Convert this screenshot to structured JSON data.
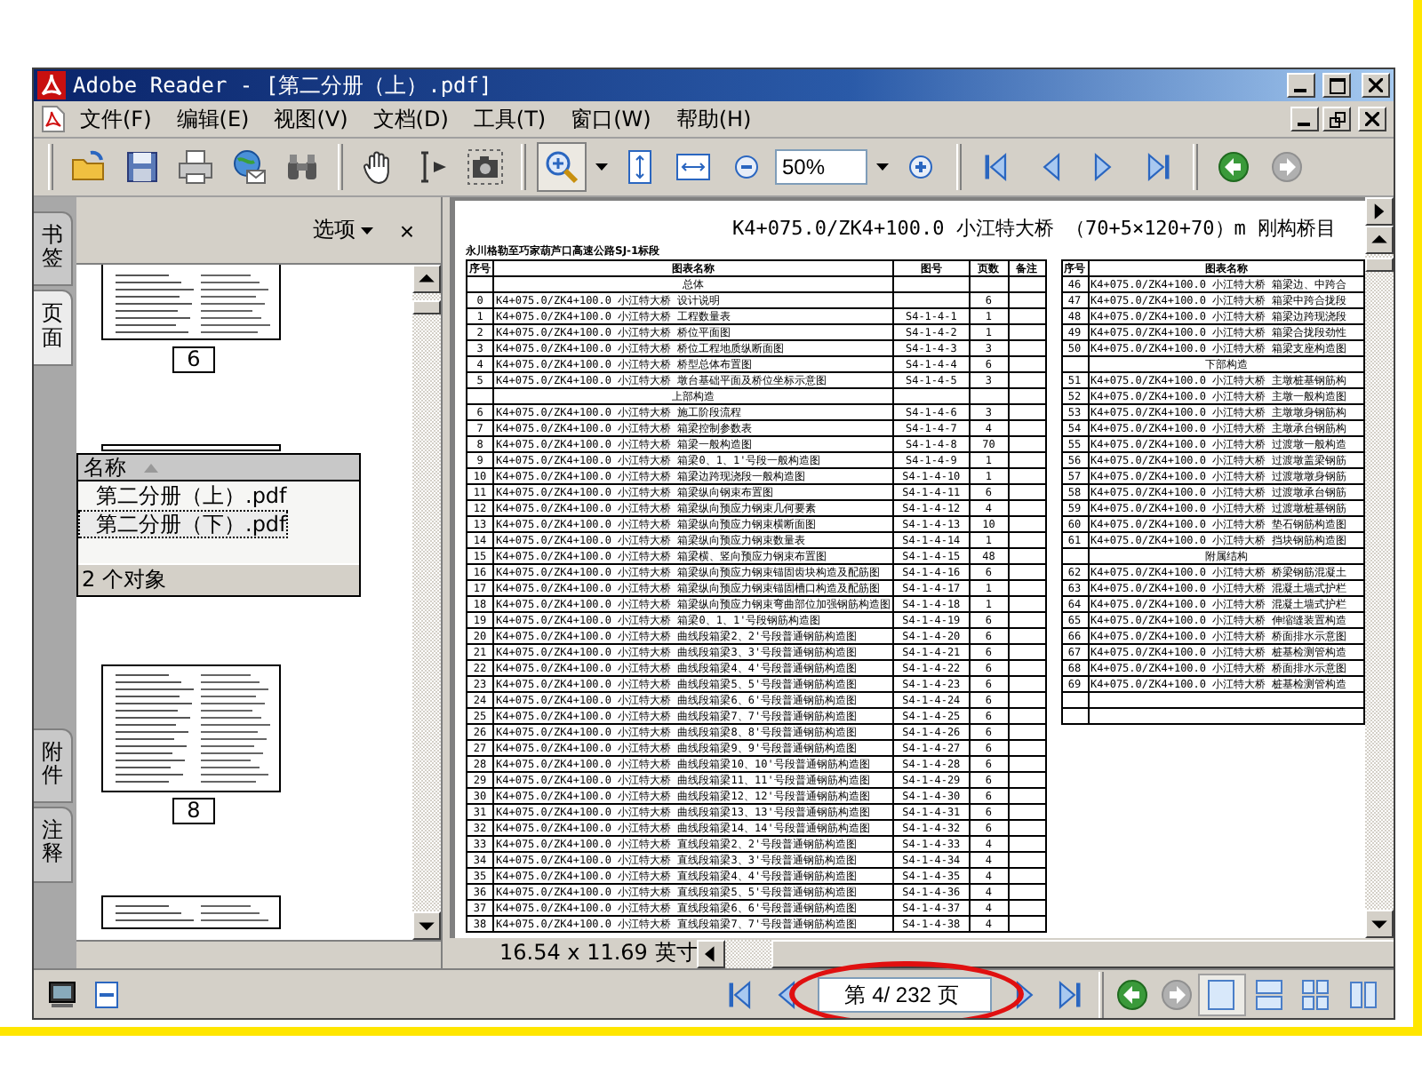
{
  "window": {
    "title": "Adobe Reader - [第二分册（上）.pdf]"
  },
  "menu": [
    {
      "label": "文件(F)"
    },
    {
      "label": "编辑(E)"
    },
    {
      "label": "视图(V)"
    },
    {
      "label": "文档(D)"
    },
    {
      "label": "工具(T)"
    },
    {
      "label": "窗口(W)"
    },
    {
      "label": "帮助(H)"
    }
  ],
  "toolbar": {
    "zoom_tool": {
      "selected": true
    },
    "zoom": {
      "value": "50%"
    },
    "history": [
      {
        "kind": "back",
        "disabled": false
      },
      {
        "kind": "forward",
        "disabled": true
      }
    ]
  },
  "side_tabs": [
    {
      "label": "书签",
      "selected": false
    },
    {
      "label": "页面",
      "selected": true
    },
    {
      "label": "附件",
      "selected": false
    },
    {
      "label": "注释",
      "selected": false
    }
  ],
  "nav_panel": {
    "options": "选项",
    "close": "×",
    "thumbnails": [
      {
        "label": "6"
      },
      {
        "label": "8"
      }
    ],
    "attachments": {
      "column": "名称",
      "files": [
        {
          "name": "第二分册（上）.pdf",
          "selected": false
        },
        {
          "name": "第二分册（下）.pdf",
          "selected": true
        }
      ],
      "count": "2 个对象"
    }
  },
  "document": {
    "title": "K4+075.0/ZK4+100.0 小江特大桥 （70+5×120+70）m 刚构桥目",
    "subtitle": "永川格勒至巧家葫芦口高速公路SJ-1标段",
    "columns": [
      "序号",
      "图表名称",
      "图号",
      "页数",
      "备注"
    ],
    "rows": [
      {
        "kind": "section",
        "name": "总体"
      },
      {
        "kind": "item",
        "no": "0",
        "name": "K4+075.0/ZK4+100.0 小江特大桥 设计说明",
        "code": "",
        "pages": "6"
      },
      {
        "kind": "item",
        "no": "1",
        "name": "K4+075.0/ZK4+100.0 小江特大桥 工程数量表",
        "code": "S4-1-4-1",
        "pages": "1"
      },
      {
        "kind": "item",
        "no": "2",
        "name": "K4+075.0/ZK4+100.0 小江特大桥 桥位平面图",
        "code": "S4-1-4-2",
        "pages": "1"
      },
      {
        "kind": "item",
        "no": "3",
        "name": "K4+075.0/ZK4+100.0 小江特大桥 桥位工程地质纵断面图",
        "code": "S4-1-4-3",
        "pages": "3"
      },
      {
        "kind": "item",
        "no": "4",
        "name": "K4+075.0/ZK4+100.0 小江特大桥 桥型总体布置图",
        "code": "S4-1-4-4",
        "pages": "6"
      },
      {
        "kind": "item",
        "no": "5",
        "name": "K4+075.0/ZK4+100.0 小江特大桥 墩台基础平面及桥位坐标示意图",
        "code": "S4-1-4-5",
        "pages": "3"
      },
      {
        "kind": "section",
        "name": "上部构造"
      },
      {
        "kind": "item",
        "no": "6",
        "name": "K4+075.0/ZK4+100.0 小江特大桥 施工阶段流程",
        "code": "S4-1-4-6",
        "pages": "3"
      },
      {
        "kind": "item",
        "no": "7",
        "name": "K4+075.0/ZK4+100.0 小江特大桥 箱梁控制参数表",
        "code": "S4-1-4-7",
        "pages": "4"
      },
      {
        "kind": "item",
        "no": "8",
        "name": "K4+075.0/ZK4+100.0 小江特大桥 箱梁一般构造图",
        "code": "S4-1-4-8",
        "pages": "70"
      },
      {
        "kind": "item",
        "no": "9",
        "name": "K4+075.0/ZK4+100.0 小江特大桥 箱梁0、1、1'号段一般构造图",
        "code": "S4-1-4-9",
        "pages": "1"
      },
      {
        "kind": "item",
        "no": "10",
        "name": "K4+075.0/ZK4+100.0 小江特大桥 箱梁边跨现浇段一般构造图",
        "code": "S4-1-4-10",
        "pages": "1"
      },
      {
        "kind": "item",
        "no": "11",
        "name": "K4+075.0/ZK4+100.0 小江特大桥 箱梁纵向钢束布置图",
        "code": "S4-1-4-11",
        "pages": "6"
      },
      {
        "kind": "item",
        "no": "12",
        "name": "K4+075.0/ZK4+100.0 小江特大桥 箱梁纵向预应力钢束几何要素",
        "code": "S4-1-4-12",
        "pages": "4"
      },
      {
        "kind": "item",
        "no": "13",
        "name": "K4+075.0/ZK4+100.0 小江特大桥 箱梁纵向预应力钢束横断面图",
        "code": "S4-1-4-13",
        "pages": "10"
      },
      {
        "kind": "item",
        "no": "14",
        "name": "K4+075.0/ZK4+100.0 小江特大桥 箱梁纵向预应力钢束数量表",
        "code": "S4-1-4-14",
        "pages": "1"
      },
      {
        "kind": "item",
        "no": "15",
        "name": "K4+075.0/ZK4+100.0 小江特大桥 箱梁横、竖向预应力钢束布置图",
        "code": "S4-1-4-15",
        "pages": "48"
      },
      {
        "kind": "item",
        "no": "16",
        "name": "K4+075.0/ZK4+100.0 小江特大桥 箱梁纵向预应力钢束锚固齿块构造及配筋图",
        "code": "S4-1-4-16",
        "pages": "6"
      },
      {
        "kind": "item",
        "no": "17",
        "name": "K4+075.0/ZK4+100.0 小江特大桥 箱梁纵向预应力钢束锚固槽口构造及配筋图",
        "code": "S4-1-4-17",
        "pages": "1"
      },
      {
        "kind": "item",
        "no": "18",
        "name": "K4+075.0/ZK4+100.0 小江特大桥 箱梁纵向预应力钢束弯曲部位加强钢筋构造图",
        "code": "S4-1-4-18",
        "pages": "1"
      },
      {
        "kind": "item",
        "no": "19",
        "name": "K4+075.0/ZK4+100.0 小江特大桥 箱梁0、1、1'号段钢筋构造图",
        "code": "S4-1-4-19",
        "pages": "6"
      },
      {
        "kind": "item",
        "no": "20",
        "name": "K4+075.0/ZK4+100.0 小江特大桥 曲线段箱梁2、2'号段普通钢筋构造图",
        "code": "S4-1-4-20",
        "pages": "6"
      },
      {
        "kind": "item",
        "no": "21",
        "name": "K4+075.0/ZK4+100.0 小江特大桥 曲线段箱梁3、3'号段普通钢筋构造图",
        "code": "S4-1-4-21",
        "pages": "6"
      },
      {
        "kind": "item",
        "no": "22",
        "name": "K4+075.0/ZK4+100.0 小江特大桥 曲线段箱梁4、4'号段普通钢筋构造图",
        "code": "S4-1-4-22",
        "pages": "6"
      },
      {
        "kind": "item",
        "no": "23",
        "name": "K4+075.0/ZK4+100.0 小江特大桥 曲线段箱梁5、5'号段普通钢筋构造图",
        "code": "S4-1-4-23",
        "pages": "6"
      },
      {
        "kind": "item",
        "no": "24",
        "name": "K4+075.0/ZK4+100.0 小江特大桥 曲线段箱梁6、6'号段普通钢筋构造图",
        "code": "S4-1-4-24",
        "pages": "6"
      },
      {
        "kind": "item",
        "no": "25",
        "name": "K4+075.0/ZK4+100.0 小江特大桥 曲线段箱梁7、7'号段普通钢筋构造图",
        "code": "S4-1-4-25",
        "pages": "6"
      },
      {
        "kind": "item",
        "no": "26",
        "name": "K4+075.0/ZK4+100.0 小江特大桥 曲线段箱梁8、8'号段普通钢筋构造图",
        "code": "S4-1-4-26",
        "pages": "6"
      },
      {
        "kind": "item",
        "no": "27",
        "name": "K4+075.0/ZK4+100.0 小江特大桥 曲线段箱梁9、9'号段普通钢筋构造图",
        "code": "S4-1-4-27",
        "pages": "6"
      },
      {
        "kind": "item",
        "no": "28",
        "name": "K4+075.0/ZK4+100.0 小江特大桥 曲线段箱梁10、10'号段普通钢筋构造图",
        "code": "S4-1-4-28",
        "pages": "6"
      },
      {
        "kind": "item",
        "no": "29",
        "name": "K4+075.0/ZK4+100.0 小江特大桥 曲线段箱梁11、11'号段普通钢筋构造图",
        "code": "S4-1-4-29",
        "pages": "6"
      },
      {
        "kind": "item",
        "no": "30",
        "name": "K4+075.0/ZK4+100.0 小江特大桥 曲线段箱梁12、12'号段普通钢筋构造图",
        "code": "S4-1-4-30",
        "pages": "6"
      },
      {
        "kind": "item",
        "no": "31",
        "name": "K4+075.0/ZK4+100.0 小江特大桥 曲线段箱梁13、13'号段普通钢筋构造图",
        "code": "S4-1-4-31",
        "pages": "6"
      },
      {
        "kind": "item",
        "no": "32",
        "name": "K4+075.0/ZK4+100.0 小江特大桥 曲线段箱梁14、14'号段普通钢筋构造图",
        "code": "S4-1-4-32",
        "pages": "6"
      },
      {
        "kind": "item",
        "no": "33",
        "name": "K4+075.0/ZK4+100.0 小江特大桥 直线段箱梁2、2'号段普通钢筋构造图",
        "code": "S4-1-4-33",
        "pages": "4"
      },
      {
        "kind": "item",
        "no": "34",
        "name": "K4+075.0/ZK4+100.0 小江特大桥 直线段箱梁3、3'号段普通钢筋构造图",
        "code": "S4-1-4-34",
        "pages": "4"
      },
      {
        "kind": "item",
        "no": "35",
        "name": "K4+075.0/ZK4+100.0 小江特大桥 直线段箱梁4、4'号段普通钢筋构造图",
        "code": "S4-1-4-35",
        "pages": "4"
      },
      {
        "kind": "item",
        "no": "36",
        "name": "K4+075.0/ZK4+100.0 小江特大桥 直线段箱梁5、5'号段普通钢筋构造图",
        "code": "S4-1-4-36",
        "pages": "4"
      },
      {
        "kind": "item",
        "no": "37",
        "name": "K4+075.0/ZK4+100.0 小江特大桥 直线段箱梁6、6'号段普通钢筋构造图",
        "code": "S4-1-4-37",
        "pages": "4"
      },
      {
        "kind": "item",
        "no": "38",
        "name": "K4+075.0/ZK4+100.0 小江特大桥 直线段箱梁7、7'号段普通钢筋构造图",
        "code": "S4-1-4-38",
        "pages": "4"
      }
    ],
    "right_columns": [
      "序号",
      "图表名称"
    ],
    "right_rows": [
      {
        "kind": "item",
        "no": "46",
        "name": "K4+075.0/ZK4+100.0 小江特大桥 箱梁边、中跨合"
      },
      {
        "kind": "item",
        "no": "47",
        "name": "K4+075.0/ZK4+100.0 小江特大桥 箱梁中跨合拢段"
      },
      {
        "kind": "item",
        "no": "48",
        "name": "K4+075.0/ZK4+100.0 小江特大桥 箱梁边跨现浇段"
      },
      {
        "kind": "item",
        "no": "49",
        "name": "K4+075.0/ZK4+100.0 小江特大桥 箱梁合拢段劲性"
      },
      {
        "kind": "item",
        "no": "50",
        "name": "K4+075.0/ZK4+100.0 小江特大桥 箱梁支座构造图"
      },
      {
        "kind": "section",
        "name": "下部构造"
      },
      {
        "kind": "item",
        "no": "51",
        "name": "K4+075.0/ZK4+100.0 小江特大桥 主墩桩基钢筋构"
      },
      {
        "kind": "item",
        "no": "52",
        "name": "K4+075.0/ZK4+100.0 小江特大桥 主墩一般构造图"
      },
      {
        "kind": "item",
        "no": "53",
        "name": "K4+075.0/ZK4+100.0 小江特大桥 主墩墩身钢筋构"
      },
      {
        "kind": "item",
        "no": "54",
        "name": "K4+075.0/ZK4+100.0 小江特大桥 主墩承台钢筋构"
      },
      {
        "kind": "item",
        "no": "55",
        "name": "K4+075.0/ZK4+100.0 小江特大桥 过渡墩一般构造"
      },
      {
        "kind": "item",
        "no": "56",
        "name": "K4+075.0/ZK4+100.0 小江特大桥 过渡墩盖梁钢筋"
      },
      {
        "kind": "item",
        "no": "57",
        "name": "K4+075.0/ZK4+100.0 小江特大桥 过渡墩墩身钢筋"
      },
      {
        "kind": "item",
        "no": "58",
        "name": "K4+075.0/ZK4+100.0 小江特大桥 过渡墩承台钢筋"
      },
      {
        "kind": "item",
        "no": "59",
        "name": "K4+075.0/ZK4+100.0 小江特大桥 过渡墩桩基钢筋"
      },
      {
        "kind": "item",
        "no": "60",
        "name": "K4+075.0/ZK4+100.0 小江特大桥 垫石钢筋构造图"
      },
      {
        "kind": "item",
        "no": "61",
        "name": "K4+075.0/ZK4+100.0 小江特大桥 挡块钢筋构造图"
      },
      {
        "kind": "section",
        "name": "附属结构"
      },
      {
        "kind": "item",
        "no": "62",
        "name": "K4+075.0/ZK4+100.0 小江特大桥 桥梁钢筋混凝土"
      },
      {
        "kind": "item",
        "no": "63",
        "name": "K4+075.0/ZK4+100.0 小江特大桥 混凝土墙式护栏"
      },
      {
        "kind": "item",
        "no": "64",
        "name": "K4+075.0/ZK4+100.0 小江特大桥 混凝土墙式护栏"
      },
      {
        "kind": "item",
        "no": "65",
        "name": "K4+075.0/ZK4+100.0 小江特大桥 伸缩缝装置构造"
      },
      {
        "kind": "item",
        "no": "66",
        "name": "K4+075.0/ZK4+100.0 小江特大桥 桥面排水示意图"
      },
      {
        "kind": "item",
        "no": "67",
        "name": "K4+075.0/ZK4+100.0 小江特大桥 桩基检测管构造"
      },
      {
        "kind": "item",
        "no": "68",
        "name": "K4+075.0/ZK4+100.0 小江特大桥 桥面排水示意图"
      },
      {
        "kind": "item",
        "no": "69",
        "name": "K4+075.0/ZK4+100.0 小江特大桥 桩基检测管构造"
      }
    ],
    "page_size": "16.54 x 11.69 英寸"
  },
  "status_bar": {
    "page_field": {
      "value": "第 4/ 232 页"
    },
    "history": [
      {
        "kind": "back",
        "disabled": false
      },
      {
        "kind": "forward",
        "disabled": true
      }
    ],
    "view_modes": [
      {
        "kind": "single",
        "selected": true
      },
      {
        "kind": "continuous",
        "selected": false
      },
      {
        "kind": "continuous-facing",
        "selected": false
      },
      {
        "kind": "facing",
        "selected": false
      }
    ]
  }
}
